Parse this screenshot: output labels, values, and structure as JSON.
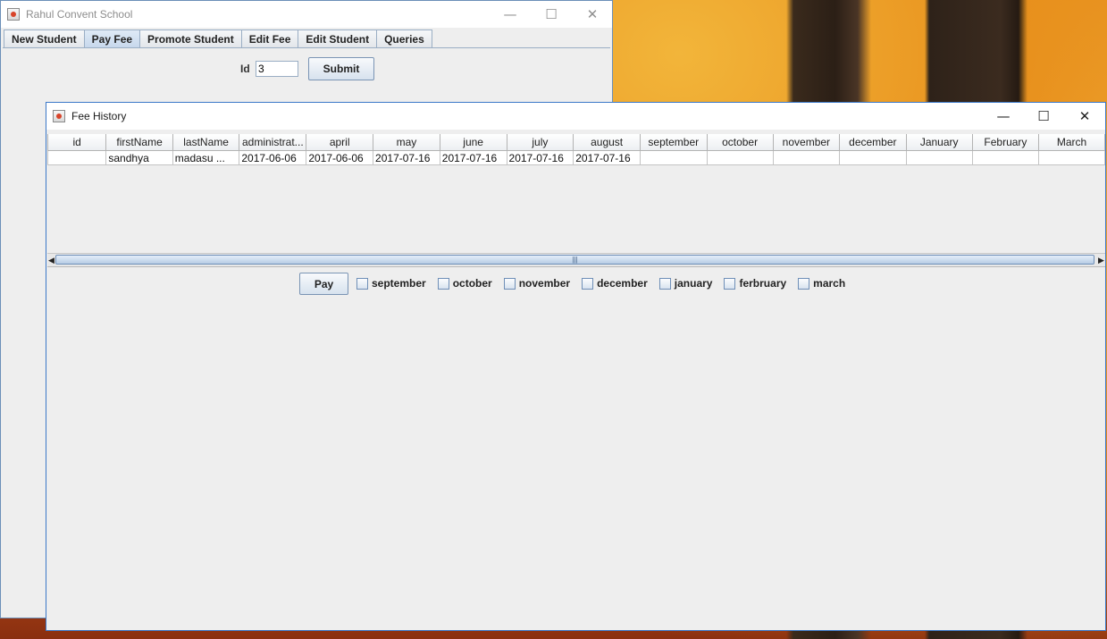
{
  "main_window": {
    "title": "Rahul Convent School",
    "controls": {
      "minimize": "—",
      "maximize": "☐",
      "close": "✕"
    },
    "tabs": [
      {
        "label": "New Student",
        "selected": false
      },
      {
        "label": "Pay Fee",
        "selected": true
      },
      {
        "label": "Promote Student",
        "selected": false
      },
      {
        "label": "Edit Fee",
        "selected": false
      },
      {
        "label": "Edit Student",
        "selected": false
      },
      {
        "label": "Queries",
        "selected": false
      }
    ],
    "id_label": "Id",
    "id_value": "3",
    "submit_label": "Submit"
  },
  "fee_window": {
    "title": "Fee History",
    "controls": {
      "minimize": "—",
      "maximize": "☐",
      "close": "✕"
    },
    "columns": [
      "id",
      "firstName",
      "lastName",
      "administrat...",
      "april",
      "may",
      "june",
      "july",
      "august",
      "september",
      "october",
      "november",
      "december",
      "January",
      "February",
      "March"
    ],
    "rows": [
      [
        "",
        "sandhya",
        "madasu     ...",
        "2017-06-06",
        "2017-06-06",
        "2017-07-16",
        "2017-07-16",
        "2017-07-16",
        "2017-07-16",
        "",
        "",
        "",
        "",
        "",
        "",
        ""
      ]
    ],
    "scrollbar": {
      "left_arrow": "◀",
      "right_arrow": "▶",
      "grip": "|||"
    },
    "pay_label": "Pay",
    "months": [
      "september",
      "october",
      "november",
      "december",
      "january",
      "ferbruary",
      "march"
    ]
  }
}
